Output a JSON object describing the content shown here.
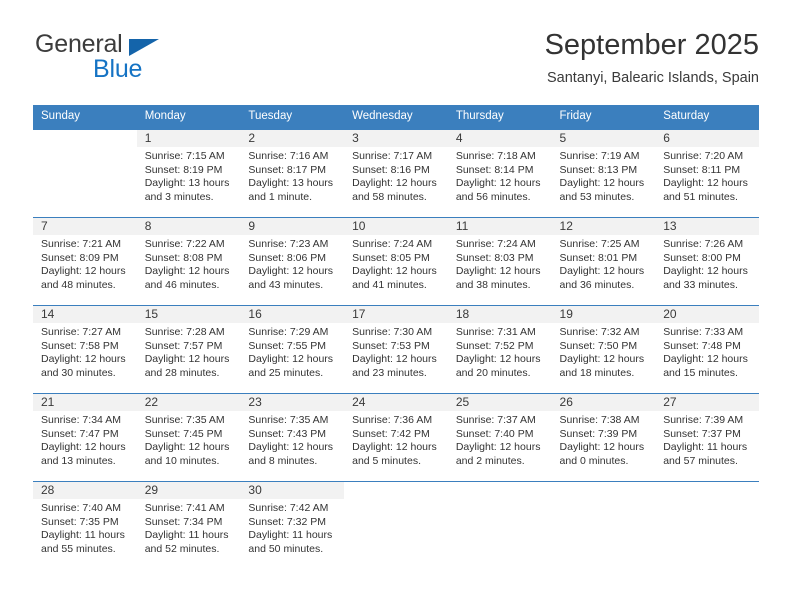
{
  "brand": {
    "name_top": "General",
    "name_bottom": "Blue",
    "accent_color": "#1573c4",
    "triangle_color": "#1464aa"
  },
  "header": {
    "title": "September 2025",
    "subtitle": "Santanyi, Balearic Islands, Spain"
  },
  "theme": {
    "header_row_bg": "#3b7fbe",
    "header_row_text": "#ffffff",
    "daynum_band_bg": "#f2f2f2",
    "row_divider": "#3b7fbe"
  },
  "calendar": {
    "weekday_headers": [
      "Sunday",
      "Monday",
      "Tuesday",
      "Wednesday",
      "Thursday",
      "Friday",
      "Saturday"
    ],
    "weeks": [
      [
        {
          "day": "",
          "sunrise": "",
          "sunset": "",
          "daylight_line1": "",
          "daylight_line2": ""
        },
        {
          "day": "1",
          "sunrise": "Sunrise: 7:15 AM",
          "sunset": "Sunset: 8:19 PM",
          "daylight_line1": "Daylight: 13 hours",
          "daylight_line2": "and 3 minutes."
        },
        {
          "day": "2",
          "sunrise": "Sunrise: 7:16 AM",
          "sunset": "Sunset: 8:17 PM",
          "daylight_line1": "Daylight: 13 hours",
          "daylight_line2": "and 1 minute."
        },
        {
          "day": "3",
          "sunrise": "Sunrise: 7:17 AM",
          "sunset": "Sunset: 8:16 PM",
          "daylight_line1": "Daylight: 12 hours",
          "daylight_line2": "and 58 minutes."
        },
        {
          "day": "4",
          "sunrise": "Sunrise: 7:18 AM",
          "sunset": "Sunset: 8:14 PM",
          "daylight_line1": "Daylight: 12 hours",
          "daylight_line2": "and 56 minutes."
        },
        {
          "day": "5",
          "sunrise": "Sunrise: 7:19 AM",
          "sunset": "Sunset: 8:13 PM",
          "daylight_line1": "Daylight: 12 hours",
          "daylight_line2": "and 53 minutes."
        },
        {
          "day": "6",
          "sunrise": "Sunrise: 7:20 AM",
          "sunset": "Sunset: 8:11 PM",
          "daylight_line1": "Daylight: 12 hours",
          "daylight_line2": "and 51 minutes."
        }
      ],
      [
        {
          "day": "7",
          "sunrise": "Sunrise: 7:21 AM",
          "sunset": "Sunset: 8:09 PM",
          "daylight_line1": "Daylight: 12 hours",
          "daylight_line2": "and 48 minutes."
        },
        {
          "day": "8",
          "sunrise": "Sunrise: 7:22 AM",
          "sunset": "Sunset: 8:08 PM",
          "daylight_line1": "Daylight: 12 hours",
          "daylight_line2": "and 46 minutes."
        },
        {
          "day": "9",
          "sunrise": "Sunrise: 7:23 AM",
          "sunset": "Sunset: 8:06 PM",
          "daylight_line1": "Daylight: 12 hours",
          "daylight_line2": "and 43 minutes."
        },
        {
          "day": "10",
          "sunrise": "Sunrise: 7:24 AM",
          "sunset": "Sunset: 8:05 PM",
          "daylight_line1": "Daylight: 12 hours",
          "daylight_line2": "and 41 minutes."
        },
        {
          "day": "11",
          "sunrise": "Sunrise: 7:24 AM",
          "sunset": "Sunset: 8:03 PM",
          "daylight_line1": "Daylight: 12 hours",
          "daylight_line2": "and 38 minutes."
        },
        {
          "day": "12",
          "sunrise": "Sunrise: 7:25 AM",
          "sunset": "Sunset: 8:01 PM",
          "daylight_line1": "Daylight: 12 hours",
          "daylight_line2": "and 36 minutes."
        },
        {
          "day": "13",
          "sunrise": "Sunrise: 7:26 AM",
          "sunset": "Sunset: 8:00 PM",
          "daylight_line1": "Daylight: 12 hours",
          "daylight_line2": "and 33 minutes."
        }
      ],
      [
        {
          "day": "14",
          "sunrise": "Sunrise: 7:27 AM",
          "sunset": "Sunset: 7:58 PM",
          "daylight_line1": "Daylight: 12 hours",
          "daylight_line2": "and 30 minutes."
        },
        {
          "day": "15",
          "sunrise": "Sunrise: 7:28 AM",
          "sunset": "Sunset: 7:57 PM",
          "daylight_line1": "Daylight: 12 hours",
          "daylight_line2": "and 28 minutes."
        },
        {
          "day": "16",
          "sunrise": "Sunrise: 7:29 AM",
          "sunset": "Sunset: 7:55 PM",
          "daylight_line1": "Daylight: 12 hours",
          "daylight_line2": "and 25 minutes."
        },
        {
          "day": "17",
          "sunrise": "Sunrise: 7:30 AM",
          "sunset": "Sunset: 7:53 PM",
          "daylight_line1": "Daylight: 12 hours",
          "daylight_line2": "and 23 minutes."
        },
        {
          "day": "18",
          "sunrise": "Sunrise: 7:31 AM",
          "sunset": "Sunset: 7:52 PM",
          "daylight_line1": "Daylight: 12 hours",
          "daylight_line2": "and 20 minutes."
        },
        {
          "day": "19",
          "sunrise": "Sunrise: 7:32 AM",
          "sunset": "Sunset: 7:50 PM",
          "daylight_line1": "Daylight: 12 hours",
          "daylight_line2": "and 18 minutes."
        },
        {
          "day": "20",
          "sunrise": "Sunrise: 7:33 AM",
          "sunset": "Sunset: 7:48 PM",
          "daylight_line1": "Daylight: 12 hours",
          "daylight_line2": "and 15 minutes."
        }
      ],
      [
        {
          "day": "21",
          "sunrise": "Sunrise: 7:34 AM",
          "sunset": "Sunset: 7:47 PM",
          "daylight_line1": "Daylight: 12 hours",
          "daylight_line2": "and 13 minutes."
        },
        {
          "day": "22",
          "sunrise": "Sunrise: 7:35 AM",
          "sunset": "Sunset: 7:45 PM",
          "daylight_line1": "Daylight: 12 hours",
          "daylight_line2": "and 10 minutes."
        },
        {
          "day": "23",
          "sunrise": "Sunrise: 7:35 AM",
          "sunset": "Sunset: 7:43 PM",
          "daylight_line1": "Daylight: 12 hours",
          "daylight_line2": "and 8 minutes."
        },
        {
          "day": "24",
          "sunrise": "Sunrise: 7:36 AM",
          "sunset": "Sunset: 7:42 PM",
          "daylight_line1": "Daylight: 12 hours",
          "daylight_line2": "and 5 minutes."
        },
        {
          "day": "25",
          "sunrise": "Sunrise: 7:37 AM",
          "sunset": "Sunset: 7:40 PM",
          "daylight_line1": "Daylight: 12 hours",
          "daylight_line2": "and 2 minutes."
        },
        {
          "day": "26",
          "sunrise": "Sunrise: 7:38 AM",
          "sunset": "Sunset: 7:39 PM",
          "daylight_line1": "Daylight: 12 hours",
          "daylight_line2": "and 0 minutes."
        },
        {
          "day": "27",
          "sunrise": "Sunrise: 7:39 AM",
          "sunset": "Sunset: 7:37 PM",
          "daylight_line1": "Daylight: 11 hours",
          "daylight_line2": "and 57 minutes."
        }
      ],
      [
        {
          "day": "28",
          "sunrise": "Sunrise: 7:40 AM",
          "sunset": "Sunset: 7:35 PM",
          "daylight_line1": "Daylight: 11 hours",
          "daylight_line2": "and 55 minutes."
        },
        {
          "day": "29",
          "sunrise": "Sunrise: 7:41 AM",
          "sunset": "Sunset: 7:34 PM",
          "daylight_line1": "Daylight: 11 hours",
          "daylight_line2": "and 52 minutes."
        },
        {
          "day": "30",
          "sunrise": "Sunrise: 7:42 AM",
          "sunset": "Sunset: 7:32 PM",
          "daylight_line1": "Daylight: 11 hours",
          "daylight_line2": "and 50 minutes."
        },
        {
          "day": "",
          "sunrise": "",
          "sunset": "",
          "daylight_line1": "",
          "daylight_line2": ""
        },
        {
          "day": "",
          "sunrise": "",
          "sunset": "",
          "daylight_line1": "",
          "daylight_line2": ""
        },
        {
          "day": "",
          "sunrise": "",
          "sunset": "",
          "daylight_line1": "",
          "daylight_line2": ""
        },
        {
          "day": "",
          "sunrise": "",
          "sunset": "",
          "daylight_line1": "",
          "daylight_line2": ""
        }
      ]
    ]
  }
}
